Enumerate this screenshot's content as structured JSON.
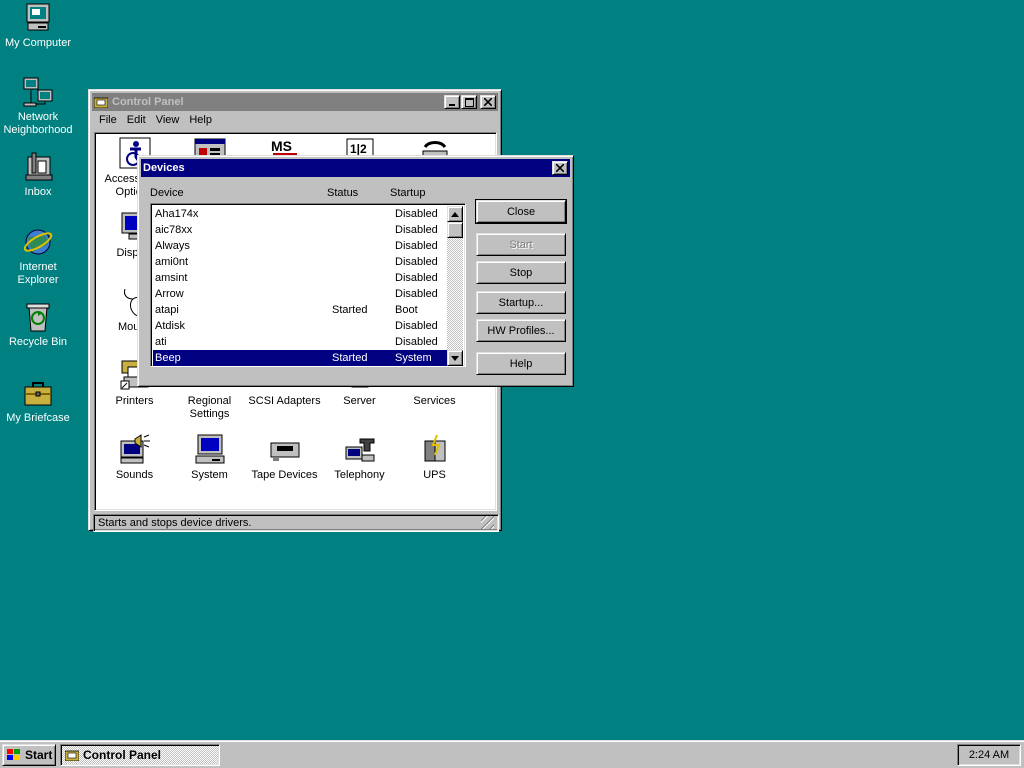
{
  "colors": {
    "desktop": "#008080",
    "active_title": "#000080",
    "inactive_title": "#808080",
    "face": "#c0c0c0"
  },
  "desktop": {
    "icons": [
      {
        "label": "My Computer",
        "icon": "computer-icon"
      },
      {
        "label": "Network Neighborhood",
        "icon": "network-icon"
      },
      {
        "label": "Inbox",
        "icon": "inbox-icon"
      },
      {
        "label": "Internet Explorer",
        "icon": "internet-explorer-icon"
      },
      {
        "label": "Recycle Bin",
        "icon": "recycle-bin-icon"
      },
      {
        "label": "My Briefcase",
        "icon": "briefcase-icon"
      }
    ]
  },
  "control_panel": {
    "title": "Control Panel",
    "menu": [
      "File",
      "Edit",
      "View",
      "Help"
    ],
    "items": {
      "accessibility": "Accessibility Options",
      "display": "Display",
      "mouse": "Mouse",
      "printers": "Printers",
      "regional": "Regional Settings",
      "scsi": "SCSI Adapters",
      "server": "Server",
      "services": "Services",
      "sounds": "Sounds",
      "system": "System",
      "tape": "Tape Devices",
      "telephony": "Telephony",
      "ups": "UPS"
    },
    "status": "Starts and stops device drivers."
  },
  "devices_dialog": {
    "title": "Devices",
    "columns": [
      "Device",
      "Status",
      "Startup"
    ],
    "rows": [
      {
        "device": "Aha174x",
        "status": "",
        "startup": "Disabled"
      },
      {
        "device": "aic78xx",
        "status": "",
        "startup": "Disabled"
      },
      {
        "device": "Always",
        "status": "",
        "startup": "Disabled"
      },
      {
        "device": "ami0nt",
        "status": "",
        "startup": "Disabled"
      },
      {
        "device": "amsint",
        "status": "",
        "startup": "Disabled"
      },
      {
        "device": "Arrow",
        "status": "",
        "startup": "Disabled"
      },
      {
        "device": "atapi",
        "status": "Started",
        "startup": "Boot"
      },
      {
        "device": "Atdisk",
        "status": "",
        "startup": "Disabled"
      },
      {
        "device": "ati",
        "status": "",
        "startup": "Disabled"
      },
      {
        "device": "Beep",
        "status": "Started",
        "startup": "System"
      }
    ],
    "selected_index": 9,
    "buttons": {
      "close": "Close",
      "start": "Start",
      "stop": "Stop",
      "startup": "Startup...",
      "hw_profiles": "HW Profiles...",
      "help": "Help"
    }
  },
  "taskbar": {
    "start_label": "Start",
    "task_label": "Control Panel",
    "clock": "2:24 AM"
  }
}
